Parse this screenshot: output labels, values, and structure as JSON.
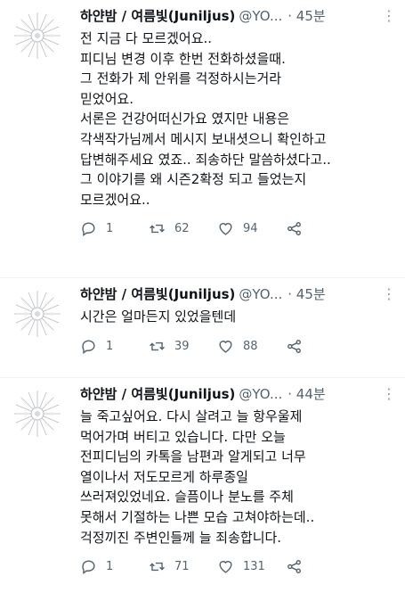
{
  "tweets": [
    {
      "name": "하얀밤 / 여름빛(Juniljus)",
      "handle": "@YO...",
      "time": "· 45분",
      "text": "전 지금 다 모르겠어요..\n피디님 변경 이후 한번 전화하셨을때.\n그 전화가 제 안위를 걱정하시는거라\n믿었어요.\n서론은 건강어떠신가요 였지만 내용은\n각색작가님께서 메시지 보내셧으니 확인하고\n답변해주세요 였죠.. 죄송하단 말씀하셨다고..\n그 이야기를 왜 시즌2확정 되고 들었는지\n모르겠어요..",
      "replies": "1",
      "retweets": "62",
      "likes": "94"
    },
    {
      "name": "하얀밤 / 여름빛(Juniljus)",
      "handle": "@YO...",
      "time": "· 45분",
      "text": "시간은 얼마든지 있었을텐데",
      "replies": "1",
      "retweets": "39",
      "likes": "88"
    },
    {
      "name": "하얀밤 / 여름빛(Juniljus)",
      "handle": "@YO...",
      "time": "· 44분",
      "text": "늘 죽고싶어요. 다시 살려고 늘 항우울제\n먹어가며 버티고 있습니다. 다만 오늘\n전피디님의 카톡을 남편과 알게되고 너무\n열이나서 저도모르게 하루종일\n쓰러져있었네요. 슬픔이나 분노를 주체\n못해서 기절하는 나쁜 모습 고쳐야하는데..\n걱정끼진 주변인들께 늘 죄송합니다.",
      "replies": "1",
      "retweets": "71",
      "likes": "131"
    }
  ],
  "icons": {
    "avatar": "sun-burst-avatar",
    "more": "more-dots-icon",
    "reply": "reply-icon",
    "retweet": "retweet-icon",
    "like": "heart-icon",
    "share": "share-icon"
  }
}
